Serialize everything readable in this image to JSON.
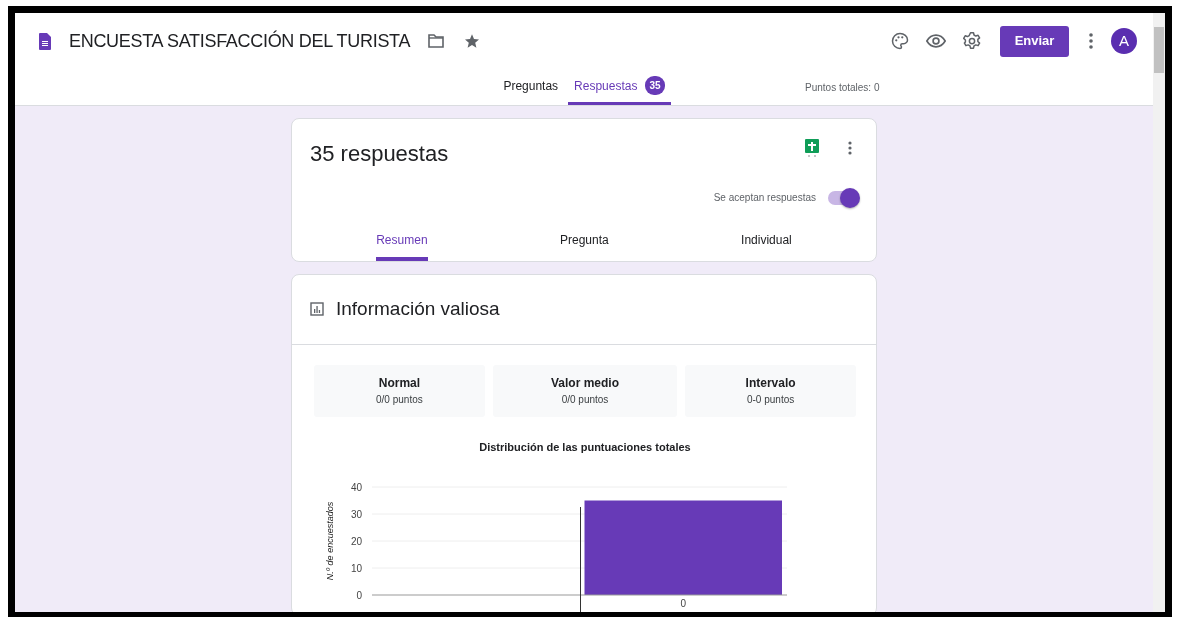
{
  "header": {
    "title": "ENCUESTA SATISFACCIÓN DEL TURISTA",
    "send_button": "Enviar",
    "avatar": "A"
  },
  "tabs": [
    {
      "label": "Preguntas",
      "selected": false
    },
    {
      "label": "Respuestas",
      "selected": true,
      "badge": "35"
    }
  ],
  "total_points": "Puntos totales: 0",
  "summary_card": {
    "title": "35 respuestas",
    "accepting": {
      "label": "Se aceptan respuestas",
      "on": true
    },
    "subtabs": [
      {
        "label": "Resumen",
        "selected": true
      },
      {
        "label": "Pregunta",
        "selected": false
      },
      {
        "label": "Individual",
        "selected": false
      }
    ]
  },
  "insights": {
    "title": "Información valiosa",
    "stats": [
      {
        "label": "Normal",
        "value": "0/0 puntos"
      },
      {
        "label": "Valor medio",
        "value": "0/0 puntos"
      },
      {
        "label": "Intervalo",
        "value": "0-0 puntos"
      }
    ],
    "chart_data": {
      "type": "bar",
      "title": "Distribución de las puntuaciones totales",
      "ylabel": "N.º de encuestados",
      "categories": [
        "0"
      ],
      "series": [
        {
          "color": "#673ab7",
          "values": [
            35
          ]
        }
      ],
      "grid": true,
      "ylim": [
        0,
        40
      ],
      "yticks": [
        0,
        10,
        20,
        30,
        40
      ]
    }
  }
}
